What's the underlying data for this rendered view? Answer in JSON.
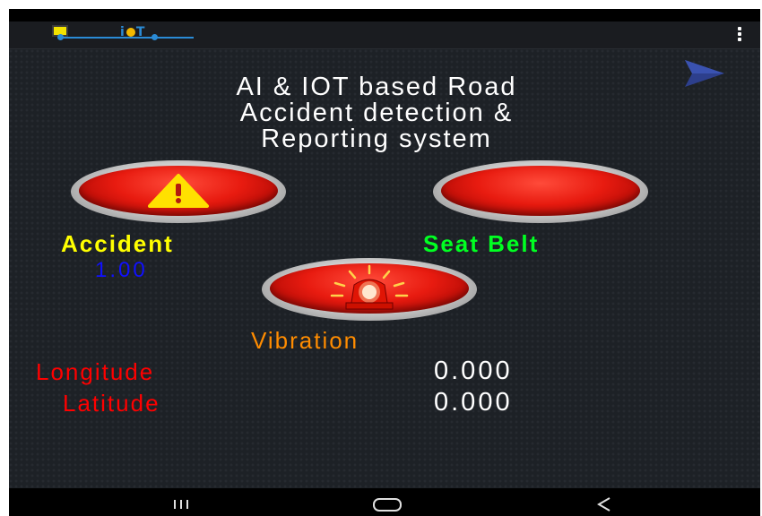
{
  "app": {
    "logo_text": {
      "i": "i",
      "t": "T"
    },
    "menu_icon": "overflow-menu-icon"
  },
  "nav": {
    "next_icon": "chevron-right-icon"
  },
  "title": {
    "line1": "AI & IOT based Road",
    "line2": "Accident detection &",
    "line3": "Reporting system"
  },
  "indicators": {
    "accident": {
      "label": "Accident",
      "value": "1.00",
      "icon": "warning-triangle-icon",
      "label_color": "#ffff00",
      "value_color": "#1010ff"
    },
    "seat_belt": {
      "label": "Seat Belt",
      "label_color": "#00ff22"
    },
    "vibration": {
      "label": "Vibration",
      "icon": "siren-icon",
      "label_color": "#ff8c00"
    }
  },
  "location": {
    "longitude_label": "Longitude",
    "longitude_value": "0.000",
    "latitude_label": "Latitude",
    "latitude_value": "0.000",
    "label_color": "#ff0000",
    "value_color": "#ffffff"
  },
  "system_nav": {
    "recents_icon": "recents-icon",
    "home_icon": "home-icon",
    "back_icon": "back-icon"
  }
}
